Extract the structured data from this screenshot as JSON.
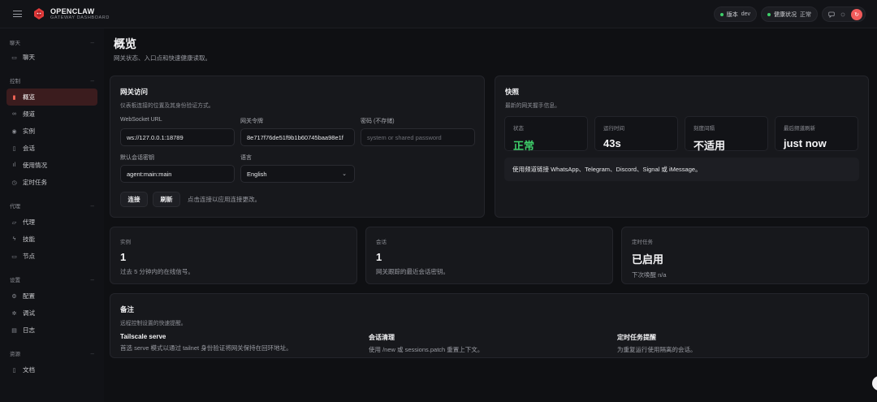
{
  "header": {
    "brand_name": "OPENCLAW",
    "brand_sub": "GATEWAY DASHBOARD",
    "version_label": "版本",
    "version_value": "dev",
    "health_label": "健康状况",
    "health_value": "正常",
    "avatar_glyph": "↻",
    "accent_color": "#f05a5a"
  },
  "sidebar": {
    "sections": [
      {
        "title": "聊天",
        "items": [
          {
            "label": "聊天",
            "icon": "chat-icon"
          }
        ]
      },
      {
        "title": "控制",
        "items": [
          {
            "label": "概览",
            "icon": "bar-chart-icon",
            "active": true
          },
          {
            "label": "频道",
            "icon": "link-icon"
          },
          {
            "label": "实例",
            "icon": "radio-icon"
          },
          {
            "label": "会话",
            "icon": "document-icon"
          },
          {
            "label": "使用情况",
            "icon": "usage-icon"
          },
          {
            "label": "定时任务",
            "icon": "clock-icon"
          }
        ]
      },
      {
        "title": "代理",
        "items": [
          {
            "label": "代理",
            "icon": "folder-icon"
          },
          {
            "label": "技能",
            "icon": "bolt-icon"
          },
          {
            "label": "节点",
            "icon": "monitor-icon"
          }
        ]
      },
      {
        "title": "设置",
        "items": [
          {
            "label": "配置",
            "icon": "gear-icon"
          },
          {
            "label": "调试",
            "icon": "bug-icon"
          },
          {
            "label": "日志",
            "icon": "log-icon"
          }
        ]
      },
      {
        "title": "资源",
        "items": [
          {
            "label": "文档",
            "icon": "book-icon"
          }
        ]
      }
    ]
  },
  "page": {
    "title": "概览",
    "subtitle": "网关状态、入口点和快速健康读取。"
  },
  "gateway_access": {
    "title": "网关访问",
    "subtitle": "仪表板连接的位置及其身份验证方式。",
    "ws_label": "WebSocket URL",
    "ws_value": "ws://127.0.0.1:18789",
    "token_label": "网关令牌",
    "token_value": "8e717f76de51f9b1b60745baa98e1f",
    "password_label": "密码 (不存储)",
    "password_placeholder": "system or shared password",
    "session_key_label": "默认会话密钥",
    "session_key_value": "agent:main:main",
    "language_label": "语言",
    "language_value": "English",
    "connect_label": "连接",
    "refresh_label": "刷新",
    "hint": "点击连接以应用连接更改。"
  },
  "snapshot": {
    "title": "快照",
    "subtitle": "最新的网关握手信息。",
    "stats": [
      {
        "label": "状态",
        "value": "正常",
        "green": true
      },
      {
        "label": "运行时间",
        "value": "43s"
      },
      {
        "label": "刻度间隔",
        "value": "不适用"
      },
      {
        "label": "最后频道刷新",
        "value": "just now"
      }
    ],
    "channel_hint": "使用频道链接 WhatsApp、Telegram、Discord、Signal 或 iMessage。"
  },
  "metrics": [
    {
      "label": "实例",
      "value": "1",
      "desc": "过去 5 分钟内的在线信号。"
    },
    {
      "label": "会话",
      "value": "1",
      "desc": "网关跟踪的最近会话密钥。"
    },
    {
      "label": "定时任务",
      "value": "已启用",
      "desc": "下次唤醒 n/a"
    }
  ],
  "notes": {
    "title": "备注",
    "subtitle": "远程控制设置的快速提醒。",
    "items": [
      {
        "title": "Tailscale serve",
        "text": "首选 serve 模式以通过 tailnet 身份验证将网关保持在回环地址。"
      },
      {
        "title": "会话清理",
        "text": "使用 /new 或 sessions.patch 重置上下文。"
      },
      {
        "title": "定时任务提醒",
        "text": "为重复运行使用隔离的会话。"
      }
    ]
  }
}
